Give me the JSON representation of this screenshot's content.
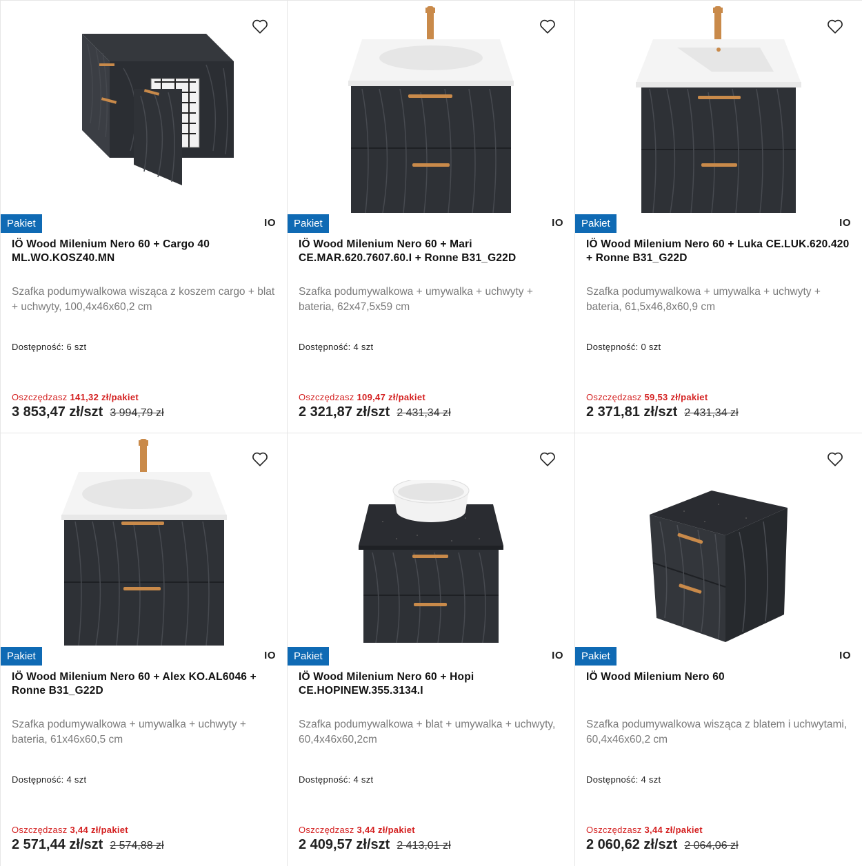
{
  "products": [
    {
      "badge": "Pakiet",
      "brand": "IO",
      "title": "IÖ Wood Milenium Nero 60 + Cargo 40 ML.WO.KOSZ40.MN",
      "description": "Szafka podumywalkowa wisząca z koszem cargo + blat + uchwyty, 100,4x46x60,2 cm",
      "availability": "Dostępność: 6 szt",
      "save_prefix": "Oszczędzasz",
      "save_amount": "141,32 zł/pakiet",
      "price": "3 853,47 zł/szt",
      "old_price": "3 994,79 zł",
      "image": "cargo-cabinet"
    },
    {
      "badge": "Pakiet",
      "brand": "IO",
      "title": "IÖ Wood Milenium Nero 60 + Mari CE.MAR.620.7607.60.I + Ronne B31_G22D",
      "description": "Szafka podumywalkowa + umywalka + uchwyty + bateria, 62x47,5x59 cm",
      "availability": "Dostępność: 4 szt",
      "save_prefix": "Oszczędzasz",
      "save_amount": "109,47 zł/pakiet",
      "price": "2 321,87 zł/szt",
      "old_price": "2 431,34 zł",
      "image": "sink-cabinet"
    },
    {
      "badge": "Pakiet",
      "brand": "IO",
      "title": "IÖ Wood Milenium Nero 60 + Luka CE.LUK.620.420 + Ronne B31_G22D",
      "description": "Szafka podumywalkowa + umywalka + uchwyty + bateria, 61,5x46,8x60,9 cm",
      "availability": "Dostępność: 0 szt",
      "save_prefix": "Oszczędzasz",
      "save_amount": "59,53 zł/pakiet",
      "price": "2 371,81 zł/szt",
      "old_price": "2 431,34 zł",
      "image": "sink-cabinet"
    },
    {
      "badge": "Pakiet",
      "brand": "IO",
      "title": "IÖ Wood Milenium Nero 60 + Alex KO.AL6046 + Ronne B31_G22D",
      "description": "Szafka podumywalkowa + umywalka + uchwyty + bateria, 61x46x60,5 cm",
      "availability": "Dostępność: 4 szt",
      "save_prefix": "Oszczędzasz",
      "save_amount": "3,44 zł/pakiet",
      "price": "2 571,44 zł/szt",
      "old_price": "2 574,88 zł",
      "image": "sink-cabinet"
    },
    {
      "badge": "Pakiet",
      "brand": "IO",
      "title": "IÖ Wood Milenium Nero 60 + Hopi CE.HOPINEW.355.3134.I",
      "description": "Szafka podumywalkowa + blat + umywalka + uchwyty, 60,4x46x60,2cm",
      "availability": "Dostępność: 4 szt",
      "save_prefix": "Oszczędzasz",
      "save_amount": "3,44 zł/pakiet",
      "price": "2 409,57 zł/szt",
      "old_price": "2 413,01 zł",
      "image": "bowl-cabinet"
    },
    {
      "badge": "Pakiet",
      "brand": "IO",
      "title": "IÖ Wood Milenium Nero 60",
      "description": "Szafka podumywalkowa wisząca z blatem i uchwytami, 60,4x46x60,2 cm",
      "availability": "Dostępność: 4 szt",
      "save_prefix": "Oszczędzasz",
      "save_amount": "3,44 zł/pakiet",
      "price": "2 060,62 zł/szt",
      "old_price": "2 064,06 zł",
      "image": "plain-cabinet"
    }
  ],
  "colors": {
    "badge": "#0f6ab4",
    "save": "#d42020",
    "wood": "#2e3136",
    "gold": "#c98a4a"
  }
}
